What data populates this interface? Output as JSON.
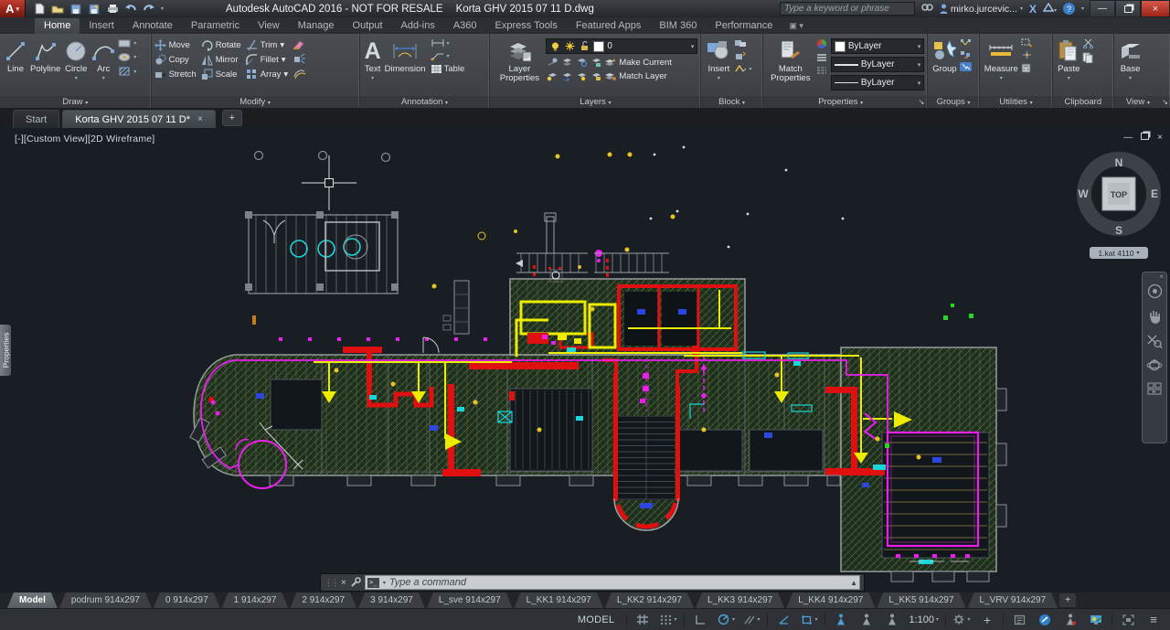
{
  "title_bar": {
    "title": "Autodesk AutoCAD 2016 - NOT FOR RESALE",
    "document": "Korta GHV 2015 07 11 D.dwg",
    "search_placeholder": "Type a keyword or phrase",
    "user": "mirko.jurcevic...",
    "help": "?"
  },
  "ribbon": {
    "tabs": [
      {
        "label": "Home"
      },
      {
        "label": "Insert"
      },
      {
        "label": "Annotate"
      },
      {
        "label": "Parametric"
      },
      {
        "label": "View"
      },
      {
        "label": "Manage"
      },
      {
        "label": "Output"
      },
      {
        "label": "Add-ins"
      },
      {
        "label": "A360"
      },
      {
        "label": "Express Tools"
      },
      {
        "label": "Featured Apps"
      },
      {
        "label": "BIM 360"
      },
      {
        "label": "Performance"
      }
    ],
    "panels": {
      "draw": {
        "label": "Draw",
        "line": "Line",
        "polyline": "Polyline",
        "circle": "Circle",
        "arc": "Arc"
      },
      "modify": {
        "label": "Modify",
        "move": "Move",
        "rotate": "Rotate",
        "trim": "Trim",
        "copy": "Copy",
        "mirror": "Mirror",
        "fillet": "Fillet",
        "stretch": "Stretch",
        "scale": "Scale",
        "array": "Array"
      },
      "annotation": {
        "label": "Annotation",
        "text": "Text",
        "dimension": "Dimension",
        "table": "Table"
      },
      "layers": {
        "label": "Layers",
        "layer_properties": "Layer Properties",
        "current_layer": "0",
        "make_current": "Make Current",
        "match_layer": "Match Layer"
      },
      "block": {
        "label": "Block",
        "insert": "Insert"
      },
      "properties": {
        "label": "Properties",
        "match_properties": "Match Properties",
        "color": "ByLayer",
        "lineweight": "ByLayer",
        "linetype": "ByLayer"
      },
      "groups": {
        "label": "Groups",
        "group": "Group"
      },
      "utilities": {
        "label": "Utilities",
        "measure": "Measure"
      },
      "clipboard": {
        "label": "Clipboard",
        "paste": "Paste"
      },
      "view": {
        "label": "View",
        "base": "Base"
      }
    }
  },
  "file_tabs": {
    "start": "Start",
    "document": "Korta GHV 2015 07 11 D*"
  },
  "canvas": {
    "viewport_label": "[-][Custom View][2D Wireframe]",
    "properties_tab": "Properties",
    "viewcube": {
      "top": "TOP",
      "n": "N",
      "s": "S",
      "e": "E",
      "w": "W",
      "pill": "1.kat 4110"
    }
  },
  "command_line": {
    "placeholder": "Type a command"
  },
  "layout_tabs": {
    "items": [
      {
        "label": "Model"
      },
      {
        "label": "podrum 914x297"
      },
      {
        "label": "0 914x297"
      },
      {
        "label": "1 914x297"
      },
      {
        "label": "2 914x297"
      },
      {
        "label": "3 914x297"
      },
      {
        "label": "L_sve 914x297"
      },
      {
        "label": "L_KK1 914x297"
      },
      {
        "label": "L_KK2 914x297"
      },
      {
        "label": "L_KK3 914x297"
      },
      {
        "label": "L_KK4 914x297"
      },
      {
        "label": "L_VRV 914x297"
      }
    ],
    "extra_tab": "L_KK5 914x297",
    "add": "+"
  },
  "status_bar": {
    "model_label": "MODEL",
    "scale": "1:100"
  }
}
